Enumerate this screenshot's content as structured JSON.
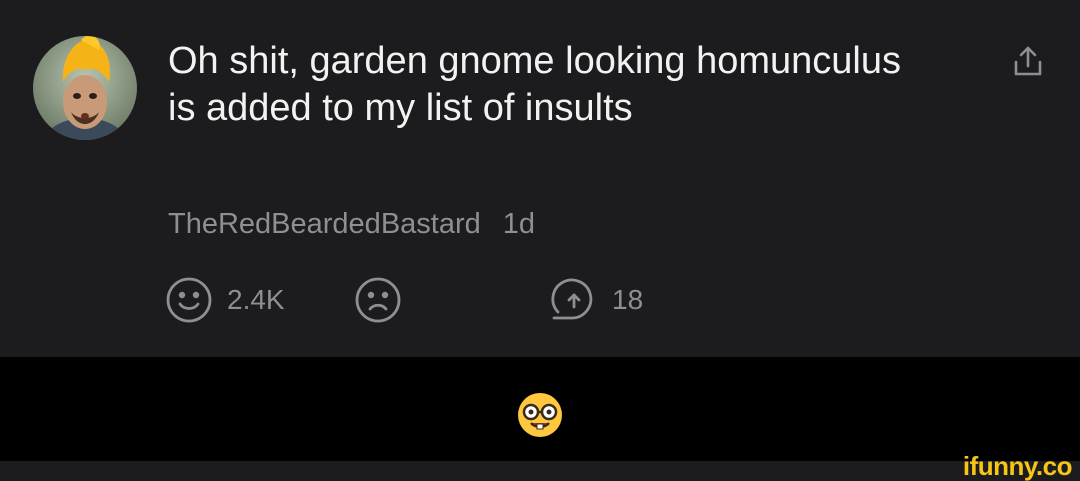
{
  "comment": {
    "text": "Oh shit, garden gnome looking homunculus is added to my list of insults",
    "username": "TheRedBeardedBastard",
    "time": "1d"
  },
  "actions": {
    "like_count": "2.4K",
    "reply_count": "18"
  },
  "icons": {
    "avatar": "avatar-icon",
    "share": "share-icon",
    "like": "smiley-icon",
    "dislike": "frowny-icon",
    "reply": "reply-icon",
    "reaction": "nerd-face-emoji"
  },
  "colors": {
    "background": "#1c1c1e",
    "text": "#f2f2f2",
    "muted": "#8e8e93",
    "watermark": "#f5c518"
  },
  "watermark": {
    "text": "ifunny.co"
  }
}
